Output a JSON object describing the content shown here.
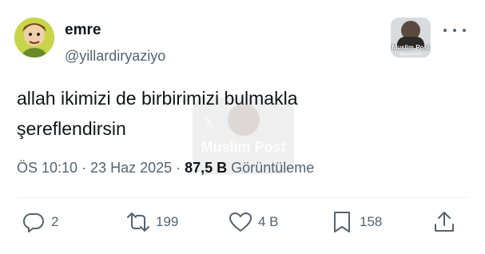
{
  "author": {
    "display_name": "emre",
    "handle": "@yillardiryaziyo"
  },
  "badge": {
    "title": "Muslim Post",
    "subtitle": "@MuslimPOST"
  },
  "watermark": {
    "text": "Muslim Post"
  },
  "tweet": {
    "text": "allah ikimizi de birbirimizi bulmakla şereflendirsin"
  },
  "meta": {
    "timestamp": "ÖS 10:10 · 23 Haz 2025 · ",
    "views_count": "87,5 B",
    "views_label": " Görüntüleme"
  },
  "actions": {
    "replies": "2",
    "reposts": "199",
    "likes": "4 B",
    "bookmarks": "158"
  },
  "icons": [
    "reply-icon",
    "repost-icon",
    "like-icon",
    "bookmark-icon",
    "share-icon",
    "more-icon"
  ],
  "colors": {
    "text": "#0f1419",
    "secondary": "#536471",
    "divider": "#eff3f4"
  }
}
